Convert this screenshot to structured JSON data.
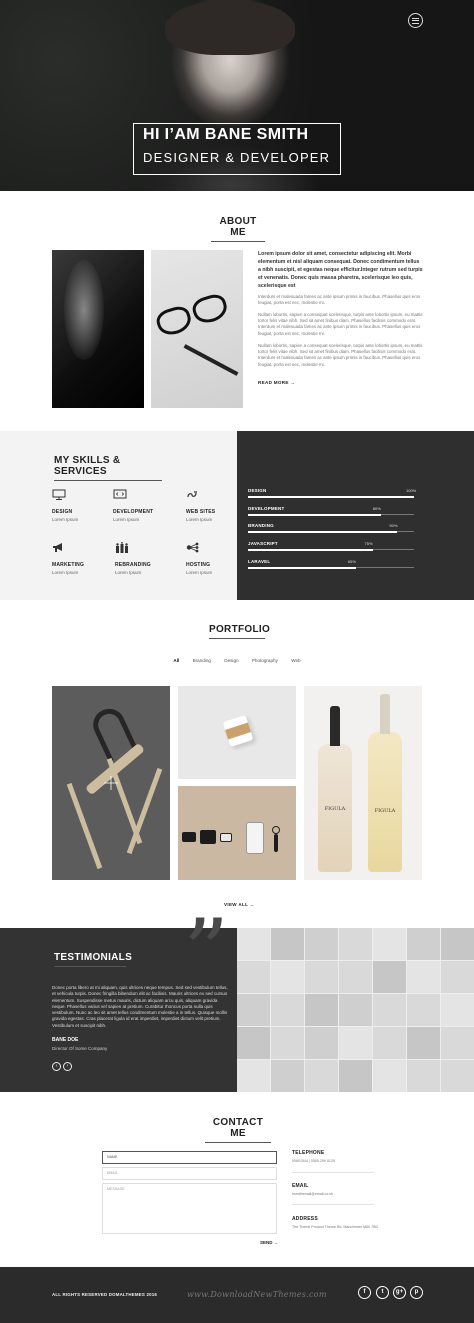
{
  "hero": {
    "title": "HI I’AM BANE SMITH",
    "subtitle": "DESIGNER & DEVELOPER",
    "menu_icon": "hamburger-menu-icon"
  },
  "about": {
    "title": "ABOUT ME",
    "lead": "Lorem ipsum dolor sit amet, consectetur adipiscing elit. Morbi elementum et nisl aliquam consequat. Donec condimentum tellus a nibh suscipit, et egestas neque efficitur.Integer rutrum sed turpis et venenatis. Donec quis massa pharetra, scelerisque leo quis, scelerisque est",
    "paragraphs": [
      "Interdum et malesuada fames ac ante ipsum primis in faucibus. Phasellus quis eros feugiat, porta est nec, molestie mi.",
      "Nullam lobortis, sapien a consequat scelerisque, turpis ante lobortis ipsum, eu mattis tortor felis vitae nibh. Sed sit amet finibus diam. Phasellus facilisis commodo erat. Interdum et malesuada fames ac ante ipsum primis in faucibus. Phasellus quis eros feugiat, porta est nec, molestie mi.",
      "Nullam lobortis, sapien a consequat scelerisque, turpis ante lobortis ipsum, eu mattis tortor felis vitae nibh. Sed sit amet finibus diam. Phasellus facilisis commodo erat. Interdum et malesuada fames ac ante ipsum primis in faucibus. Phasellus quis eros feugiat, porta est nec, molestie mi."
    ],
    "read_more": "READ MORE →"
  },
  "skills": {
    "title": "MY SKILLS & SERVICES",
    "services": [
      {
        "name": "DESIGN",
        "desc": "Lorem Ipsum",
        "icon": "monitor-icon"
      },
      {
        "name": "DEVELOPMENT",
        "desc": "Lorem Ipsum",
        "icon": "code-icon"
      },
      {
        "name": "WEB SITES",
        "desc": "Lorem Ipsum",
        "icon": "link-icon"
      },
      {
        "name": "MARKETING",
        "desc": "Lorem Ipsum",
        "icon": "megaphone-icon"
      },
      {
        "name": "REBRANDING",
        "desc": "Lorem Ipsum",
        "icon": "people-icon"
      },
      {
        "name": "HOSTING",
        "desc": "Lorem Ipsum",
        "icon": "network-icon"
      }
    ],
    "bars": [
      {
        "label": "DESIGN",
        "percent": 100,
        "percent_label": "100%"
      },
      {
        "label": "DEVELOPMENT",
        "percent": 80,
        "percent_label": "80%"
      },
      {
        "label": "BRANDING",
        "percent": 90,
        "percent_label": "90%"
      },
      {
        "label": "JAVASCRIPT",
        "percent": 75,
        "percent_label": "75%"
      },
      {
        "label": "LARAVEL",
        "percent": 65,
        "percent_label": "65%"
      }
    ]
  },
  "portfolio": {
    "title": "PORTFOLIO",
    "filters": [
      "All",
      "Branding",
      "Design",
      "Photography",
      "Web"
    ],
    "active_filter": "All",
    "wine_label_1": "FIGULA",
    "wine_label_2": "FIGULA",
    "view_all": "VIEW ALL →"
  },
  "testimonials": {
    "title": "TESTIMONIALS",
    "quote": "Donec porta libero at mi aliquam, quis ultrices neque tempus. Sed sed vestibulum tellus, et vehicula turpis. Donec fringilla bibendum elit ac facilisis. Mauris ultrices ex sed cursus elementum. Suspendisse metus mauris, dictum aliquam arcu quis, aliquam gravida neque. Phasellus varius vel sapien at pretium. Curabitur rhoncus porta nulla quis vestibulum. Nunc ac leo sit amet tellus condimentum molestie a in tellus. Quisque mollis gravida egestas. Cras placerat ligula id erat imperdiet, imperdiet dictum velit pretium. Vestibulum et suscipit nibh.",
    "name": "BANE DOE",
    "role": "Director Of Some Company",
    "prev": "‹",
    "next": "›"
  },
  "contact": {
    "title": "CONTACT ME",
    "name_placeholder": "NAME",
    "email_placeholder": "EMAIL",
    "message_placeholder": "MESSAGE",
    "send": "SEND →",
    "telephone_label": "TELEPHONE",
    "telephone_value": "00801544 | 0555 299 0129",
    "email_label": "EMAIL",
    "email_value": "hsmithemail@email.co.uk",
    "address_label": "ADDRESS",
    "address_value": "The Theme Product Theme Rd, Manchester M60 7BD"
  },
  "footer": {
    "copyright": "ALL RIGHTS RESERVED DOMALTHEMES 2016",
    "watermark": "www.DownloadNewThemes.com",
    "social": [
      {
        "label": "f",
        "icon": "facebook-icon"
      },
      {
        "label": "t",
        "icon": "twitter-icon"
      },
      {
        "label": "g+",
        "icon": "google-plus-icon"
      },
      {
        "label": "p",
        "icon": "pinterest-icon"
      }
    ]
  },
  "colors": {
    "dark": "#2f2f2f",
    "light_bg": "#f3f3f3",
    "accent": "#ffffff"
  }
}
